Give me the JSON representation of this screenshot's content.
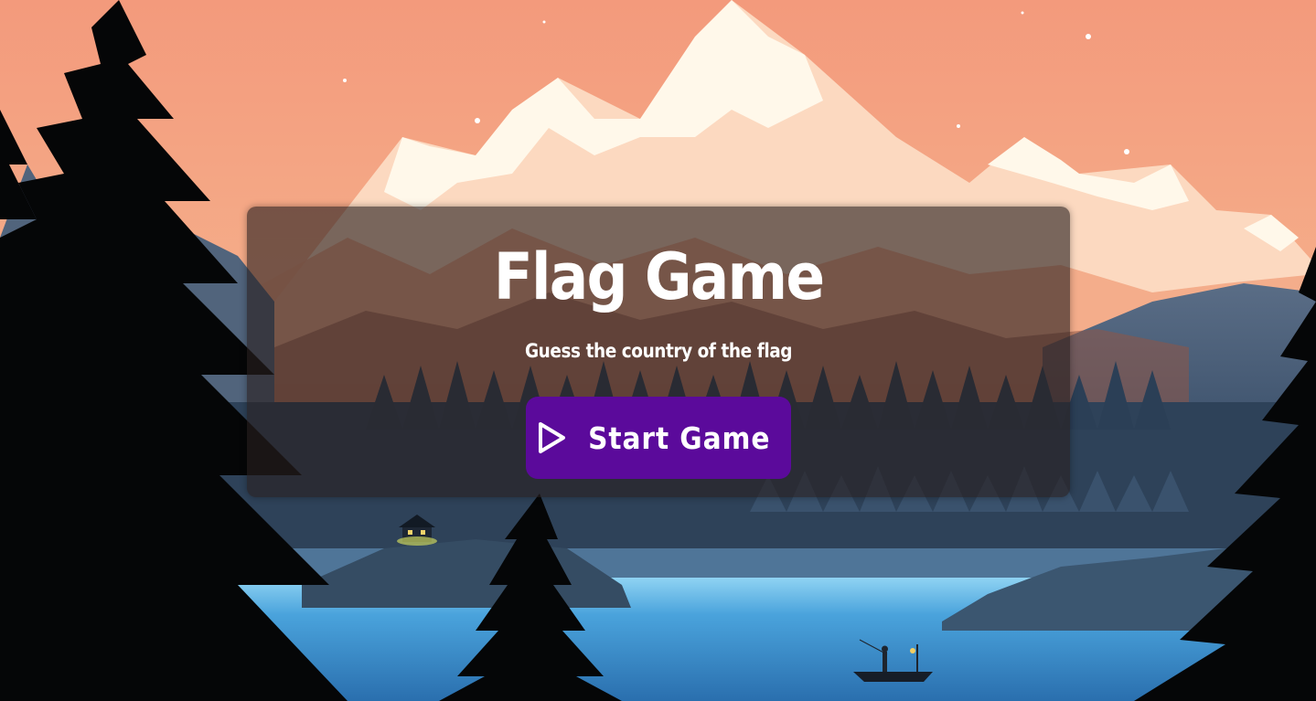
{
  "background": {
    "description_icon": "mountain-lake-landscape",
    "sky_color": "#f4a07e",
    "lake_color": "#3d86c2"
  },
  "card": {
    "title": "Flag Game",
    "subtitle": "Guess the country of the flag",
    "start_button": {
      "icon": "play-icon",
      "label": "Start Game",
      "color": "#5b0a9b"
    }
  }
}
